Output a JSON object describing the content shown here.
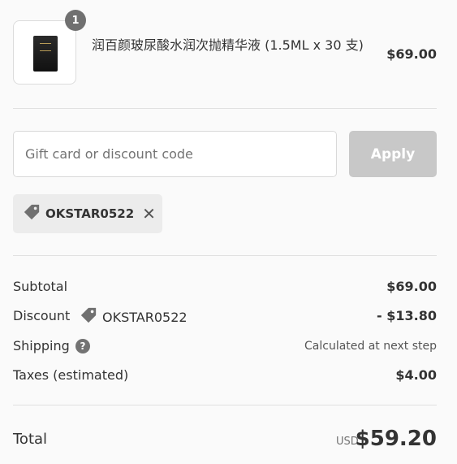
{
  "product": {
    "quantity": "1",
    "name": "润百颜玻尿酸水润次抛精华液 (1.5ML x 30 支)",
    "price": "$69.00"
  },
  "discount_form": {
    "placeholder": "Gift card or discount code",
    "apply_label": "Apply"
  },
  "applied_code": {
    "code": "OKSTAR0522",
    "remove_symbol": "✕"
  },
  "summary": {
    "subtotal_label": "Subtotal",
    "subtotal_value": "$69.00",
    "discount_label": "Discount",
    "discount_code": "OKSTAR0522",
    "discount_value": "- $13.80",
    "shipping_label": "Shipping",
    "shipping_help_symbol": "?",
    "shipping_value": "Calculated at next step",
    "taxes_label": "Taxes (estimated)",
    "taxes_value": "$4.00"
  },
  "total": {
    "label": "Total",
    "currency": "USD",
    "amount": "$59.20"
  },
  "icons": {
    "tag": "tag-icon",
    "remove": "close-icon",
    "help": "question-circle-icon"
  },
  "colors": {
    "button_disabled": "#c8c8c8",
    "tag_background": "#ececec",
    "badge": "#707070"
  }
}
